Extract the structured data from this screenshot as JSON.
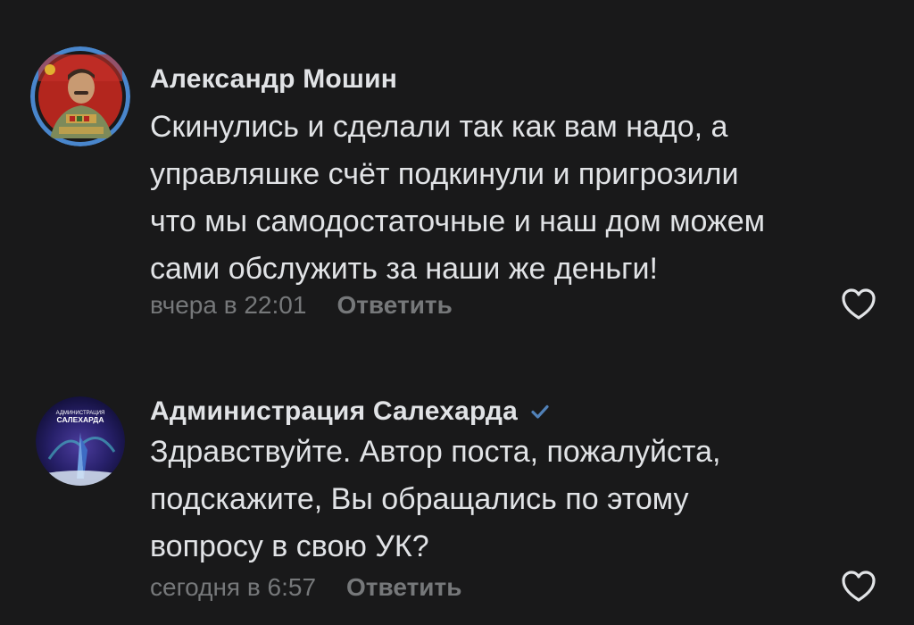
{
  "comments": [
    {
      "author": "Александр Мошин",
      "text": "Скинулись и сделали так как вам надо, а\nуправляшке счёт подкинули и пригрозили\nчто мы самодостаточные и наш дом можем\nсами обслужить за наши же деньги!",
      "time": "вчера в 22:01",
      "reply_label": "Ответить",
      "avatar_icon": "portrait-avatar-icon",
      "verified": false
    },
    {
      "author": "Администрация Салехарда",
      "text": "Здравствуйте. Автор поста, пожалуйста,\nподскажите, Вы обращались по этому\nвопросу в свою УК?",
      "time": "сегодня в 6:57",
      "reply_label": "Ответить",
      "avatar_label_line1": "АДМИНИСТРАЦИЯ",
      "avatar_label_line2": "САЛЕХАРДА",
      "avatar_icon": "city-emblem-avatar-icon",
      "verified": true
    }
  ],
  "colors": {
    "background": "#19191a",
    "text_primary": "#e1e3e6",
    "text_secondary": "#76787a",
    "verified": "#5181b8",
    "avatar_ring": "#4986cc"
  }
}
